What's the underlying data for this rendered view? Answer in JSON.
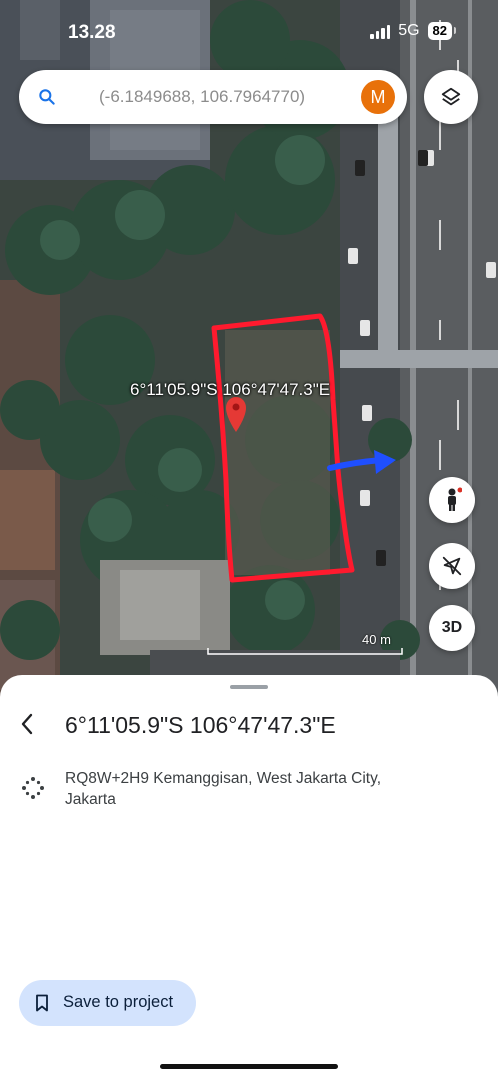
{
  "status_bar": {
    "time": "13.28",
    "network": "5G",
    "battery": "82"
  },
  "search": {
    "text": "(-6.1849688, 106.7964770)",
    "avatar_letter": "M"
  },
  "map": {
    "coordinate_label": "6°11'05.9\"S 106°47'47.3\"E",
    "scale_label": "40 m",
    "button_3d_label": "3D"
  },
  "sheet": {
    "title": "6°11'05.9\"S 106°47'47.3\"E",
    "address_line1": "RQ8W+2H9 Kemanggisan, West Jakarta City,",
    "address_line2": "Jakarta",
    "save_button_label": "Save to project"
  },
  "colors": {
    "avatar": "#e8710a",
    "annotation_outline": "#ff1a2e",
    "annotation_arrow": "#1f4fff",
    "pin": "#e53935",
    "save_button_bg": "#d3e3fd"
  },
  "icons": [
    "search-icon",
    "layers-icon",
    "pegman-icon",
    "location-off-icon",
    "back-arrow-icon",
    "plus-code-icon",
    "bookmark-icon"
  ]
}
